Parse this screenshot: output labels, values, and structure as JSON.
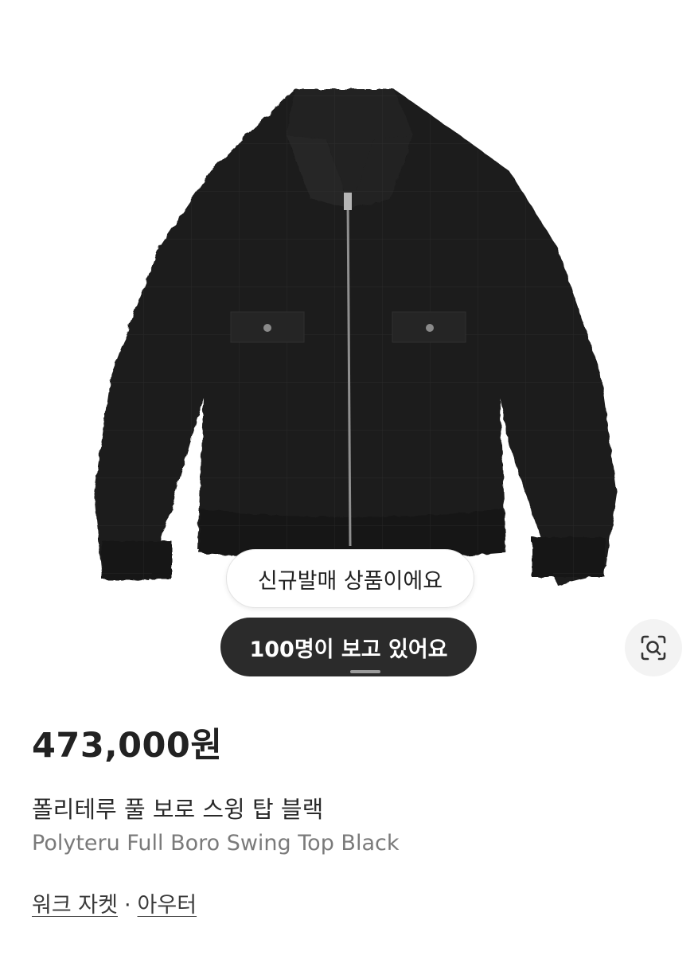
{
  "product": {
    "image_alt": "jacket-photo",
    "badge_new": "신규발매 상품이에요",
    "badge_viewers": "100명이 보고 있어요",
    "carousel": {
      "total": 2,
      "active": 1
    },
    "lens_button_icon": "image-search-icon",
    "price": "473,000원",
    "name_ko": "폴리테루 풀 보로 스윙 탑 블랙",
    "name_en": "Polyteru Full Boro Swing Top Black",
    "category": {
      "primary": "워크 자켓",
      "separator": "·",
      "secondary": "아우터"
    }
  },
  "colors": {
    "dark_pill": "#2b2b2b",
    "jacket": "#1b1b1b",
    "text": "#222222",
    "subtext": "#7a7a7a"
  }
}
